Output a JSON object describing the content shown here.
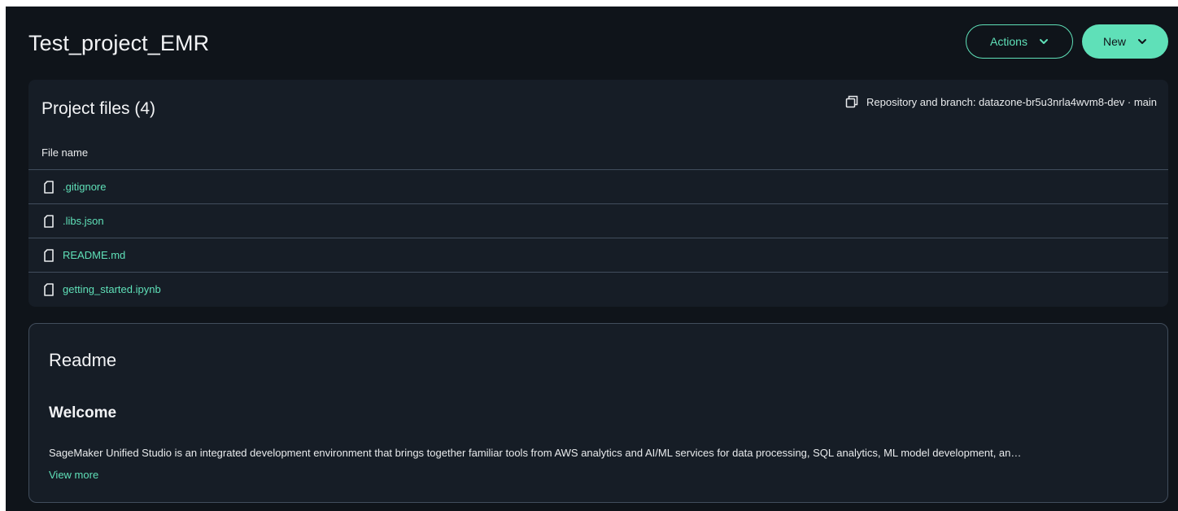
{
  "header": {
    "title": "Test_project_EMR",
    "actions_label": "Actions",
    "new_label": "New"
  },
  "files": {
    "title": "Project files (4)",
    "repo_text": "Repository and branch: datazone-br5u3nrla4wvm8-dev · main",
    "column_header": "File name",
    "items": [
      {
        "name": ".gitignore"
      },
      {
        "name": ".libs.json"
      },
      {
        "name": "README.md"
      },
      {
        "name": "getting_started.ipynb"
      }
    ]
  },
  "readme": {
    "title": "Readme",
    "heading": "Welcome",
    "text": "SageMaker Unified Studio is an integrated development environment that brings together familiar tools from AWS analytics and AI/ML services for data processing, SQL analytics, ML model development, an…",
    "view_more": "View more"
  },
  "icons": {
    "actions_chevron": "chevron-down-icon",
    "new_chevron": "chevron-down-icon",
    "repo": "copy-icon",
    "file": "file-icon"
  },
  "colors": {
    "background": "#0f141a",
    "card": "#161d26",
    "accent": "#5fe0b8",
    "divider": "#414d5c"
  }
}
